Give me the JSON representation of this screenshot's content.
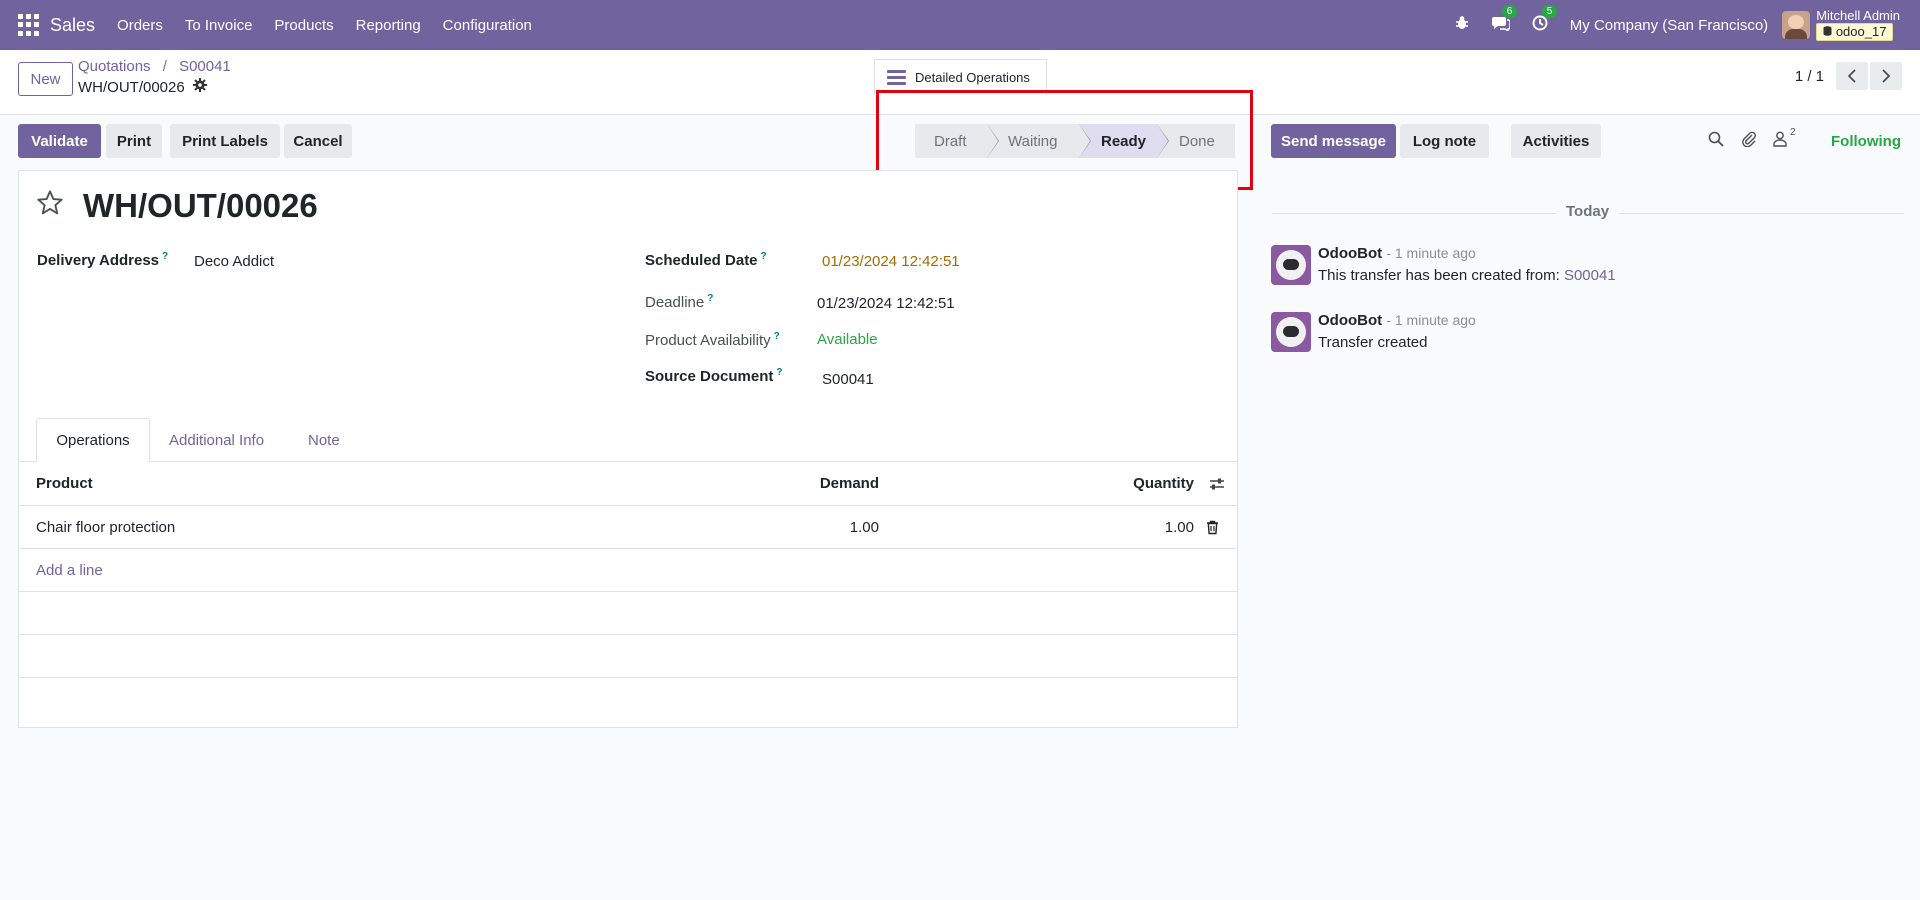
{
  "navbar": {
    "app_name": "Sales",
    "menu": [
      "Orders",
      "To Invoice",
      "Products",
      "Reporting",
      "Configuration"
    ],
    "bug_icon": "bug-icon",
    "messages_badge": "6",
    "activities_badge": "5",
    "company": "My Company (San Francisco)",
    "user_name": "Mitchell Admin",
    "db_name": "odoo_17"
  },
  "control": {
    "new_label": "New",
    "breadcrumb": [
      "Quotations",
      "S00041"
    ],
    "record_name": "WH/OUT/00026",
    "detailed_ops_label": "Detailed Operations",
    "pager": "1 / 1"
  },
  "actions": {
    "validate": "Validate",
    "print": "Print",
    "print_labels": "Print Labels",
    "cancel": "Cancel"
  },
  "status": {
    "stages": [
      "Draft",
      "Waiting",
      "Ready",
      "Done"
    ],
    "current": "Ready",
    "highlight_color": "#e3000f"
  },
  "form": {
    "title": "WH/OUT/00026",
    "delivery_address_label": "Delivery Address",
    "delivery_address": "Deco Addict",
    "scheduled_date_label": "Scheduled Date",
    "scheduled_date": "01/23/2024 12:42:51",
    "deadline_label": "Deadline",
    "deadline": "01/23/2024 12:42:51",
    "availability_label": "Product Availability",
    "availability": "Available",
    "source_doc_label": "Source Document",
    "source_doc": "S00041",
    "help_mark": "?"
  },
  "tabs": [
    "Operations",
    "Additional Info",
    "Note"
  ],
  "table": {
    "headers": {
      "product": "Product",
      "demand": "Demand",
      "quantity": "Quantity"
    },
    "rows": [
      {
        "product": "Chair floor protection",
        "demand": "1.00",
        "quantity": "1.00"
      }
    ],
    "add_line": "Add a line"
  },
  "chatter": {
    "send_message": "Send message",
    "log_note": "Log note",
    "activities": "Activities",
    "followers_count": "2",
    "following": "Following",
    "today": "Today",
    "messages": [
      {
        "author": "OdooBot",
        "time": "- 1 minute ago",
        "body": "This transfer has been created from: ",
        "link": "S00041"
      },
      {
        "author": "OdooBot",
        "time": "- 1 minute ago",
        "body": "Transfer created",
        "link": ""
      }
    ]
  }
}
